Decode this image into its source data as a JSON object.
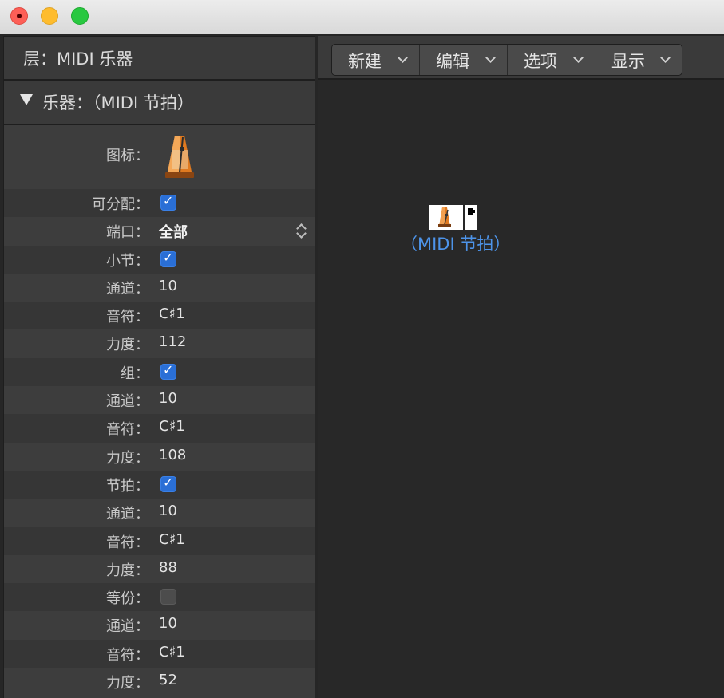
{
  "inspector": {
    "header_label": "层：MIDI 乐器",
    "sub_label": "乐器：（MIDI 节拍）",
    "rows": [
      {
        "label": "图标：",
        "type": "icon"
      },
      {
        "label": "可分配：",
        "type": "checkbox",
        "checked": true
      },
      {
        "label": "端口：",
        "type": "select",
        "value": "全部"
      },
      {
        "label": "小节：",
        "type": "checkbox",
        "checked": true
      },
      {
        "label": "通道：",
        "type": "text",
        "value": "10"
      },
      {
        "label": "音符：",
        "type": "text",
        "value": "C♯1"
      },
      {
        "label": "力度：",
        "type": "text",
        "value": "112"
      },
      {
        "label": "组：",
        "type": "checkbox",
        "checked": true
      },
      {
        "label": "通道：",
        "type": "text",
        "value": "10"
      },
      {
        "label": "音符：",
        "type": "text",
        "value": "C♯1"
      },
      {
        "label": "力度：",
        "type": "text",
        "value": "108"
      },
      {
        "label": "节拍：",
        "type": "checkbox",
        "checked": true
      },
      {
        "label": "通道：",
        "type": "text",
        "value": "10"
      },
      {
        "label": "音符：",
        "type": "text",
        "value": "C♯1"
      },
      {
        "label": "力度：",
        "type": "text",
        "value": "88"
      },
      {
        "label": "等份：",
        "type": "checkbox",
        "checked": false
      },
      {
        "label": "通道：",
        "type": "text",
        "value": "10"
      },
      {
        "label": "音符：",
        "type": "text",
        "value": "C♯1"
      },
      {
        "label": "力度：",
        "type": "text",
        "value": "52"
      }
    ]
  },
  "toolbar": {
    "menus": [
      {
        "label": "新建"
      },
      {
        "label": "编辑"
      },
      {
        "label": "选项"
      },
      {
        "label": "显示"
      }
    ]
  },
  "environment": {
    "object_label": "（MIDI 节拍）",
    "object_icon": "metronome-icon"
  },
  "colors": {
    "accent": "#2a6fd6",
    "object_label": "#4d94ea"
  }
}
